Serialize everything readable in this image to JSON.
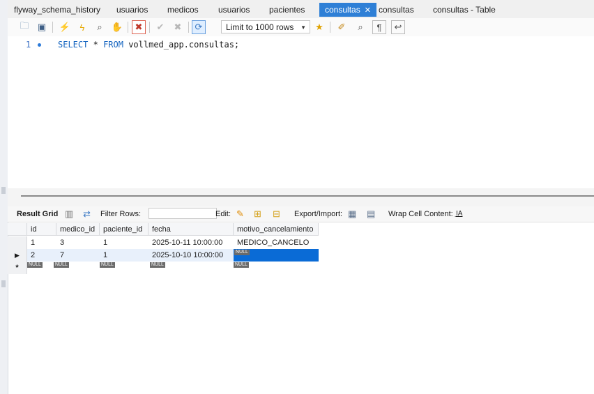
{
  "tabs": [
    "flyway_schema_history",
    "usuarios",
    "medicos",
    "usuarios",
    "pacientes",
    "consultas",
    "consultas",
    "consultas - Table"
  ],
  "active_tab_index": 5,
  "toolbar": {
    "limit_label": "Limit to 1000 rows"
  },
  "editor": {
    "line_number": "1",
    "sql_kw1": "SELECT",
    "sql_star": "*",
    "sql_kw2": "FROM",
    "sql_table": "vollmed_app.consultas;"
  },
  "result_toolbar": {
    "result_grid_label": "Result Grid",
    "filter_rows_label": "Filter Rows:",
    "edit_label": "Edit:",
    "export_label": "Export/Import:",
    "wrap_label": "Wrap Cell Content:"
  },
  "grid": {
    "columns": [
      "id",
      "medico_id",
      "paciente_id",
      "fecha",
      "motivo_cancelamiento"
    ],
    "rows": [
      [
        "1",
        "3",
        "1",
        "2025-10-11 10:00:00",
        "MEDICO_CANCELO"
      ],
      [
        "2",
        "7",
        "1",
        "2025-10-10 10:00:00",
        "NULL"
      ]
    ],
    "new_row": [
      "NULL",
      "NULL",
      "NULL",
      "NULL",
      "NULL"
    ],
    "new_row_marker": "*",
    "current_row_marker": "▶"
  },
  "colors": {
    "active_tab": "#2e7fd6",
    "selection": "#0a6bd6",
    "keyword": "#1565c0"
  }
}
